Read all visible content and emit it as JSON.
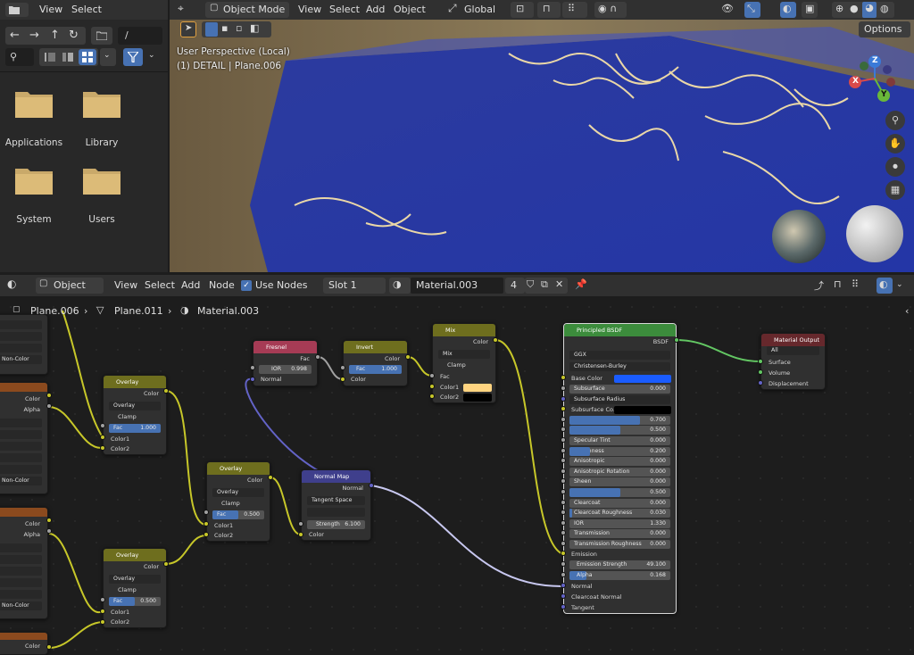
{
  "file_browser": {
    "menu": [
      "View",
      "Select"
    ],
    "path": "/",
    "folders": [
      "Applications",
      "Library",
      "System",
      "Users"
    ]
  },
  "viewport": {
    "mode": "Object Mode",
    "menu": [
      "View",
      "Select",
      "Add",
      "Object"
    ],
    "orientation": "Global",
    "options": "Options",
    "info_line1": "User Perspective (Local)",
    "info_line2": "(1) DETAIL | Plane.006",
    "gizmo": {
      "x": "X",
      "y": "Y",
      "z": "Z"
    }
  },
  "node_editor": {
    "object_dropdown": "Object",
    "menu": [
      "View",
      "Select",
      "Add",
      "Node"
    ],
    "use_nodes": "Use Nodes",
    "slot": "Slot 1",
    "material": "Material.003",
    "users": "4",
    "breadcrumb": [
      "Plane.006",
      "Plane.011",
      "Material.003"
    ],
    "header_colors": {
      "fresnel": "#a63b55",
      "color": "#6e6e1e",
      "vector": "#3f3f8c",
      "shader": "#3c8c3c",
      "output": "#66282c"
    },
    "nodes": {
      "fresnel": {
        "title": "Fresnel",
        "out": "Fac",
        "ior_label": "IOR",
        "ior": "0.998",
        "normal": "Normal"
      },
      "invert": {
        "title": "Invert",
        "out": "Color",
        "fac_label": "Fac",
        "fac": "1.000",
        "color": "Color"
      },
      "mix": {
        "title": "Mix",
        "out": "Color",
        "blend": "Mix",
        "clamp": "Clamp",
        "fac": "Fac",
        "color1": "Color1",
        "color2": "Color2",
        "color1_value": "#ffd480",
        "color2_value": "#000000"
      },
      "overlay1": {
        "title": "Overlay",
        "out": "Color",
        "blend": "Overlay",
        "clamp": "Clamp",
        "fac_label": "Fac",
        "fac": "1.000",
        "color1": "Color1",
        "color2": "Color2"
      },
      "overlay2": {
        "title": "Overlay",
        "out": "Color",
        "blend": "Overlay",
        "clamp": "Clamp",
        "fac_label": "Fac",
        "fac": "0.500",
        "color1": "Color1",
        "color2": "Color2"
      },
      "overlay3": {
        "title": "Overlay",
        "out": "Color",
        "blend": "Overlay",
        "clamp": "Clamp",
        "fac_label": "Fac",
        "fac": "0.500",
        "color1": "Color1",
        "color2": "Color2"
      },
      "normal_map": {
        "title": "Normal Map",
        "out": "Normal",
        "space": "Tangent Space",
        "strength_label": "Strength",
        "strength": "6.100",
        "color": "Color"
      },
      "principled": {
        "title": "Principled BSDF",
        "out": "BSDF",
        "distribution": "GGX",
        "subsurface_method": "Christensen-Burley",
        "base_color": "Base Color",
        "base_color_value": "#1a5cff",
        "rows": [
          {
            "label": "Subsurface",
            "value": "0.000",
            "fill": 0
          },
          {
            "label": "Subsurface Radius",
            "value": "",
            "fill": 0,
            "dropdown": true
          },
          {
            "label": "Subsurface Co...",
            "value": "",
            "fill": 0,
            "swatch": "#000000"
          },
          {
            "label": "Metallic",
            "value": "0.700",
            "fill": 0.7
          },
          {
            "label": "Specular",
            "value": "0.500",
            "fill": 0.5
          },
          {
            "label": "Specular Tint",
            "value": "0.000",
            "fill": 0
          },
          {
            "label": "Roughness",
            "value": "0.200",
            "fill": 0.2
          },
          {
            "label": "Anisotropic",
            "value": "0.000",
            "fill": 0
          },
          {
            "label": "Anisotropic Rotation",
            "value": "0.000",
            "fill": 0
          },
          {
            "label": "Sheen",
            "value": "0.000",
            "fill": 0
          },
          {
            "label": "Sheen Tint",
            "value": "0.500",
            "fill": 0.5
          },
          {
            "label": "Clearcoat",
            "value": "0.000",
            "fill": 0
          },
          {
            "label": "Clearcoat Roughness",
            "value": "0.030",
            "fill": 0.03
          },
          {
            "label": "IOR",
            "value": "1.330",
            "fill": 0
          },
          {
            "label": "Transmission",
            "value": "0.000",
            "fill": 0
          },
          {
            "label": "Transmission Roughness",
            "value": "0.000",
            "fill": 0
          }
        ],
        "emission": "Emission",
        "emission_strength_label": "Emission Strength",
        "emission_strength": "49.100",
        "alpha_label": "Alpha",
        "alpha": "0.168",
        "alpha_fill": 0.168,
        "normal": "Normal",
        "clearcoat_normal": "Clearcoat Normal",
        "tangent": "Tangent"
      },
      "output": {
        "title": "Material Output",
        "target": "All",
        "surface": "Surface",
        "volume": "Volume",
        "displacement": "Displacement"
      },
      "left_partial": {
        "color": "Color",
        "alpha": "Alpha",
        "noncolor": "Non-Color"
      }
    }
  }
}
